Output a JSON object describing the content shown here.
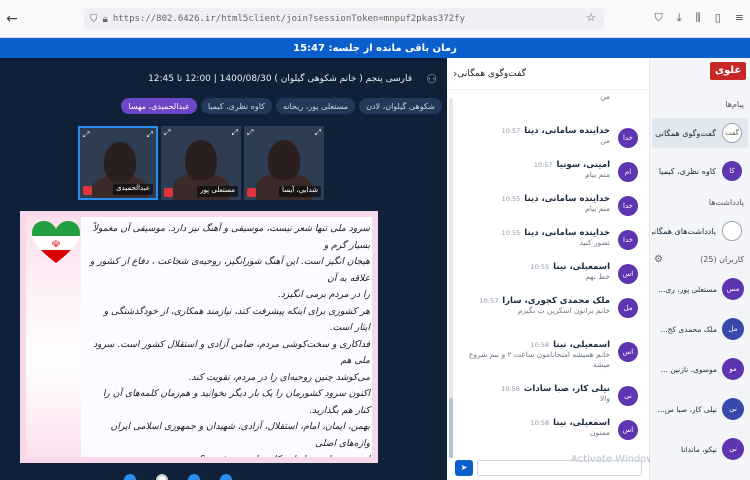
{
  "browser": {
    "url": "https://802.6426.ir/html5client/join?sessionToken=mnpuf2pkas372fy"
  },
  "timer": {
    "text": "زمان باقی مانده از جلسه: 15:47"
  },
  "main": {
    "info": "فارسی پنجم ( خانم شکوهی گیلوان ) 1400/08/30 | 12:00 تا 12:45",
    "chips": [
      {
        "label": "شکوهی گیلوان، لادن",
        "presenter": false
      },
      {
        "label": "مستعلی پور، ریحانه",
        "presenter": false
      },
      {
        "label": "کاوه نظری، کیمیا",
        "presenter": false
      },
      {
        "label": "عبدالحمیدی، مهسا",
        "presenter": true
      }
    ],
    "tiles": [
      {
        "name": "عبدالحمیدی",
        "active": true
      },
      {
        "name": "مستعلی پور",
        "active": false
      },
      {
        "name": "شدایی، آیسا",
        "active": false
      }
    ],
    "slide_lines": [
      "سرود ملی تنها شعر نیست، موسیقی و آهنگ نیز دارد. موسیقی آن معمولاً بسیار گرم و",
      "هیجان انگیز است. این آهنگ شورانگیز، روحیه‌ی شجاعت ، دفاع از کشور و علاقه به آن",
      "را در مردم برمی انگیزد.",
      "هر کشوری برای اینکه پیشرفت کند، نیازمند همکاری، از خودگذشتگی و ایثار است.",
      "فداکاری و سخت‌کوشی مردم، ضامن آزادی و استقلال کشور است. سرود ملی هم",
      "می‌کوشد چنین روحیه‌ای را در مردم، تقویت کند.",
      "اکنون سرود کشورمان را یک بار دیگر بخوانید و هم‌زمان کلمه‌های آن را کنار هم بگذارید.",
      "بهمن، ایمان، امام، استقلال، آزادی، شهیدان و جمهوری اسلامی ایران واژه‌های اصلی",
      "این سرود است. از این کلمه‌ها چه می‌فهمیم؟"
    ]
  },
  "chat": {
    "title": "گفت‌وگوی همگانی",
    "messages": [
      {
        "av": "",
        "who": "",
        "time": "",
        "txt": "من"
      },
      {
        "av": "خدا",
        "who": "خداینده سامانی، دینا",
        "time": "10:57",
        "txt": "من"
      },
      {
        "av": "ام",
        "who": "امینی، سونیا",
        "time": "10:57",
        "txt": "منم بیام"
      },
      {
        "av": "خدا",
        "who": "خداینده سامانی، دینا",
        "time": "10:55",
        "txt": "منم بیام"
      },
      {
        "av": "خدا",
        "who": "خداینده سامانی، دینا",
        "time": "10:55",
        "txt": "تصور کنید"
      },
      {
        "av": "اس",
        "who": "اسمعیلی، نینا",
        "time": "10:55",
        "txt": "خط نهم"
      },
      {
        "av": "مل",
        "who": "ملک محمدی کجوری، سارا",
        "time": "10:57",
        "txt": "خانم برانون اسکرین ب بگیرم",
        "tall": true
      },
      {
        "av": "اس",
        "who": "اسمعیلی، نینا",
        "time": "10:58",
        "txt": "خانم همیشه امتحانامون ساعت ۲ و نیم شروع میشه",
        "tall": true
      },
      {
        "av": "نی",
        "who": "نیلی کار، صبا سادات",
        "time": "10:58",
        "txt": "والا"
      },
      {
        "av": "اس",
        "who": "اسمعیلی، نینا",
        "time": "10:58",
        "txt": "ممنون"
      }
    ],
    "watermark": "Activate Windows"
  },
  "side": {
    "logo": "علوی",
    "sections": {
      "messages": "پیام‌ها",
      "notes": "یادداشت‌ها",
      "users": "کاربران (25)"
    },
    "items": [
      {
        "icon": "گفت",
        "label": "گفت‌وگوی همگانی",
        "selected": true,
        "color": "#ffffff"
      },
      {
        "icon": "کا",
        "label": "کاوه نظری، کیمیا",
        "selected": false,
        "color": "#5e35b1"
      },
      {
        "icon": "",
        "label": "یادداشت‌های همگانی",
        "selected": false,
        "color": "#ffffff"
      }
    ],
    "users": [
      {
        "icon": "مس",
        "label": "مستعلی پور، ری...",
        "color": "#5e35b1"
      },
      {
        "icon": "مل",
        "label": "ملک محمدی کج...",
        "color": "#3949ab"
      },
      {
        "icon": "مو",
        "label": "موسوی، نازنین ...",
        "color": "#5e35b1"
      },
      {
        "icon": "نی",
        "label": "نیلی کار، صبا س...",
        "color": "#3949ab"
      },
      {
        "icon": "نی",
        "label": "نیکو، ماندانا",
        "color": "#5e35b1"
      }
    ]
  }
}
